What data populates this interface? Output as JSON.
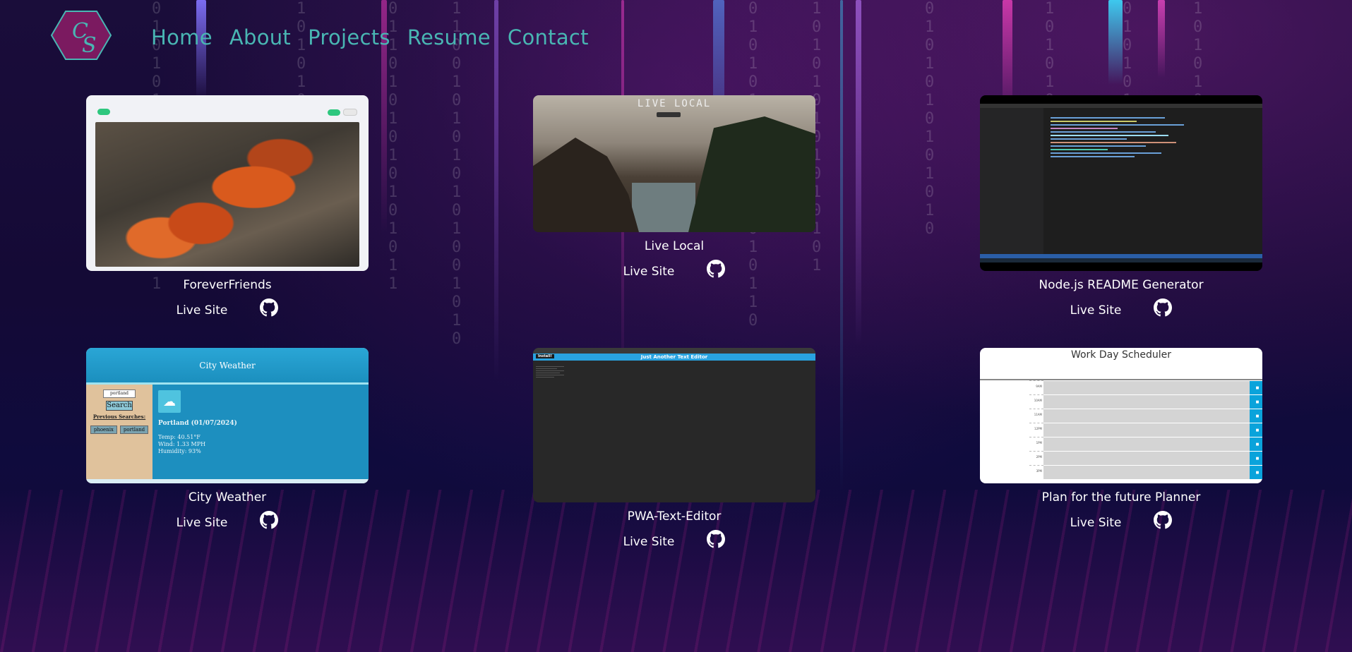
{
  "nav": {
    "logo_text": "CS",
    "items": [
      {
        "label": "Home"
      },
      {
        "label": "About"
      },
      {
        "label": "Projects"
      },
      {
        "label": "Resume"
      },
      {
        "label": "Contact"
      }
    ]
  },
  "colors": {
    "nav_text": "#49b6b3",
    "logo_fill": "#7b1a60",
    "logo_accent": "#49b6b3",
    "card_text": "#ffffff"
  },
  "projects": [
    {
      "title": "ForeverFriends",
      "live_label": "Live Site",
      "repo_icon": "github-icon"
    },
    {
      "title": "Live Local",
      "live_label": "Live Site",
      "repo_icon": "github-icon",
      "thumb_heading": "LIVE LOCAL"
    },
    {
      "title": "Node.js README Generator",
      "live_label": "Live Site",
      "repo_icon": "github-icon"
    },
    {
      "title": "City Weather",
      "live_label": "Live Site",
      "repo_icon": "github-icon",
      "thumb": {
        "header": "City Weather",
        "input_value": "portland",
        "search_label": "Search",
        "previous_label": "Previous Searches:",
        "history": [
          "phoenix",
          "portland"
        ],
        "city": "Portland (01/07/2024)",
        "temp": "Temp: 40.51°F",
        "wind": "Wind: 1.33 MPH",
        "humidity": "Humidity: 93%"
      }
    },
    {
      "title": "PWA-Text-Editor",
      "live_label": "Live Site",
      "repo_icon": "github-icon",
      "thumb": {
        "header": "Just Another Text Editor",
        "install_label": "Install!"
      }
    },
    {
      "title": "Plan for the future Planner",
      "live_label": "Live Site",
      "repo_icon": "github-icon",
      "thumb": {
        "header": "Work Day Scheduler",
        "hours": [
          "9AM",
          "10AM",
          "11AM",
          "12PM",
          "1PM",
          "2PM",
          "3PM"
        ]
      }
    }
  ]
}
